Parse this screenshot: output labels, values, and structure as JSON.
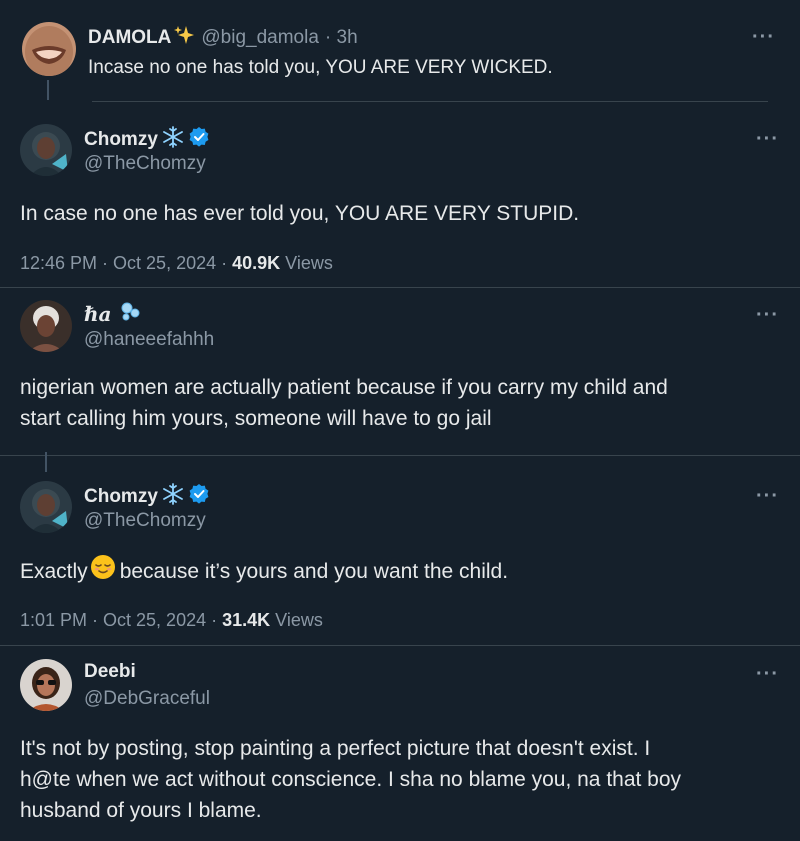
{
  "tweets": [
    {
      "name": "DAMOLA",
      "handle": "@big_damola",
      "time": "· 3h",
      "text": "Incase no one has told you, YOU ARE VERY WICKED."
    },
    {
      "name": "Chomzy",
      "handle": "@TheChomzy",
      "text": "In case no one has ever told you, YOU ARE VERY STUPID.",
      "timestamp": "12:46 PM · Oct 25, 2024 · ",
      "views_count": "40.9K",
      "views_label": " Views"
    },
    {
      "name": "ℏa",
      "handle": "@haneeefahhh",
      "text_line1": "nigerian women are actually patient because if you carry my child and",
      "text_line2": "start calling him yours, someone will have to go jail"
    },
    {
      "name": "Chomzy",
      "handle": "@TheChomzy",
      "text_before": "Exactly",
      "text_after": " because it’s yours and you want the child.",
      "timestamp": "1:01 PM · Oct 25, 2024 · ",
      "views_count": "31.4K",
      "views_label": " Views"
    },
    {
      "name": "Deebi",
      "handle": "@DebGraceful",
      "text_line1": "It's not by posting, stop painting a perfect picture that doesn't exist.  I",
      "text_line2": "h@te when we act without conscience.  I sha no blame you, na that boy",
      "text_line3": "husband of yours I blame."
    }
  ],
  "more_label": "···",
  "icons": [
    "sparkles-icon",
    "snowflake-icon",
    "verified-badge-icon",
    "bubbles-icon",
    "relieved-face-emoji",
    "more-options-icon"
  ],
  "colors": {
    "background": "#15202b",
    "verified": "#1d9bf0",
    "divider": "#38444d"
  }
}
